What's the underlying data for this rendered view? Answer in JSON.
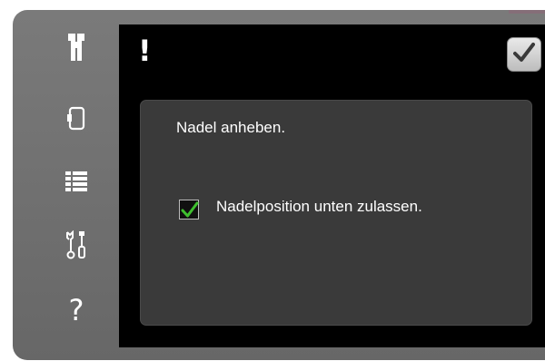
{
  "header": {
    "alert_symbol": "!",
    "confirm_icon": "check-icon"
  },
  "sidebar": {
    "items": [
      {
        "icon": "presser-foot-icon"
      },
      {
        "icon": "hoop-icon"
      },
      {
        "icon": "list-menu-icon"
      },
      {
        "icon": "tools-icon"
      },
      {
        "icon": "help-icon",
        "symbol": "?"
      }
    ]
  },
  "dialog": {
    "message": "Nadel anheben.",
    "checkbox_label": "Nadelposition unten zulassen.",
    "checkbox_checked": true
  },
  "colors": {
    "frame": "#6d6d6d",
    "screen": "#000000",
    "panel": "#3a3a3a",
    "check_green": "#3fbf2f"
  }
}
